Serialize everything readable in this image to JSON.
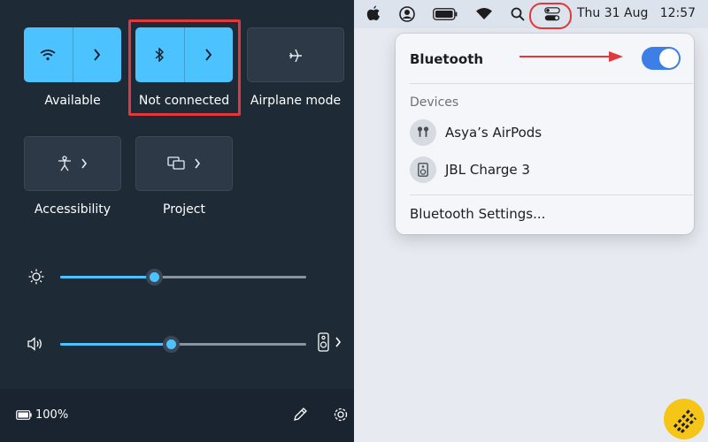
{
  "windows": {
    "tiles": [
      {
        "id": "wifi",
        "label": "Available",
        "state": "on",
        "icon": "wifi-icon",
        "has_chevron": true
      },
      {
        "id": "bluetooth",
        "label": "Not connected",
        "state": "on",
        "icon": "bluetooth-icon",
        "has_chevron": true
      },
      {
        "id": "airplane",
        "label": "Airplane mode",
        "state": "off",
        "icon": "airplane-icon",
        "has_chevron": false
      },
      {
        "id": "accessibility",
        "label": "Accessibility",
        "state": "off",
        "icon": "accessibility-icon",
        "has_chevron": true
      },
      {
        "id": "project",
        "label": "Project",
        "state": "off",
        "icon": "project-icon",
        "has_chevron": true
      }
    ],
    "brightness": {
      "icon": "brightness-icon",
      "level": 0.38
    },
    "volume": {
      "icon": "speaker-icon",
      "level": 0.45,
      "output_icon": "speaker-device-icon"
    },
    "battery": {
      "icon": "battery-icon",
      "percent_text": "100%"
    },
    "footer_icons": [
      "edit-icon",
      "settings-icon"
    ]
  },
  "mac": {
    "menubar": {
      "icons": [
        "apple-icon",
        "user-icon",
        "battery-icon",
        "wifi-icon",
        "search-icon",
        "control-center-icon"
      ],
      "clock_text": "Thu 31 Aug   12:57"
    },
    "bluetooth_popover": {
      "title": "Bluetooth",
      "toggle_on": true,
      "devices_label": "Devices",
      "devices": [
        {
          "name": "Asya’s AirPods",
          "icon": "airpods-icon"
        },
        {
          "name": "JBL Charge 3",
          "icon": "speaker-icon"
        }
      ],
      "settings_link": "Bluetooth Settings..."
    }
  },
  "annotations": {
    "highlight_color": "#e0383d",
    "arrow_color": "#e0383d"
  },
  "colors": {
    "win_accent": "#4cc2ff",
    "win_bg": "#1f2a37",
    "mac_toggle": "#3d7fe6"
  }
}
